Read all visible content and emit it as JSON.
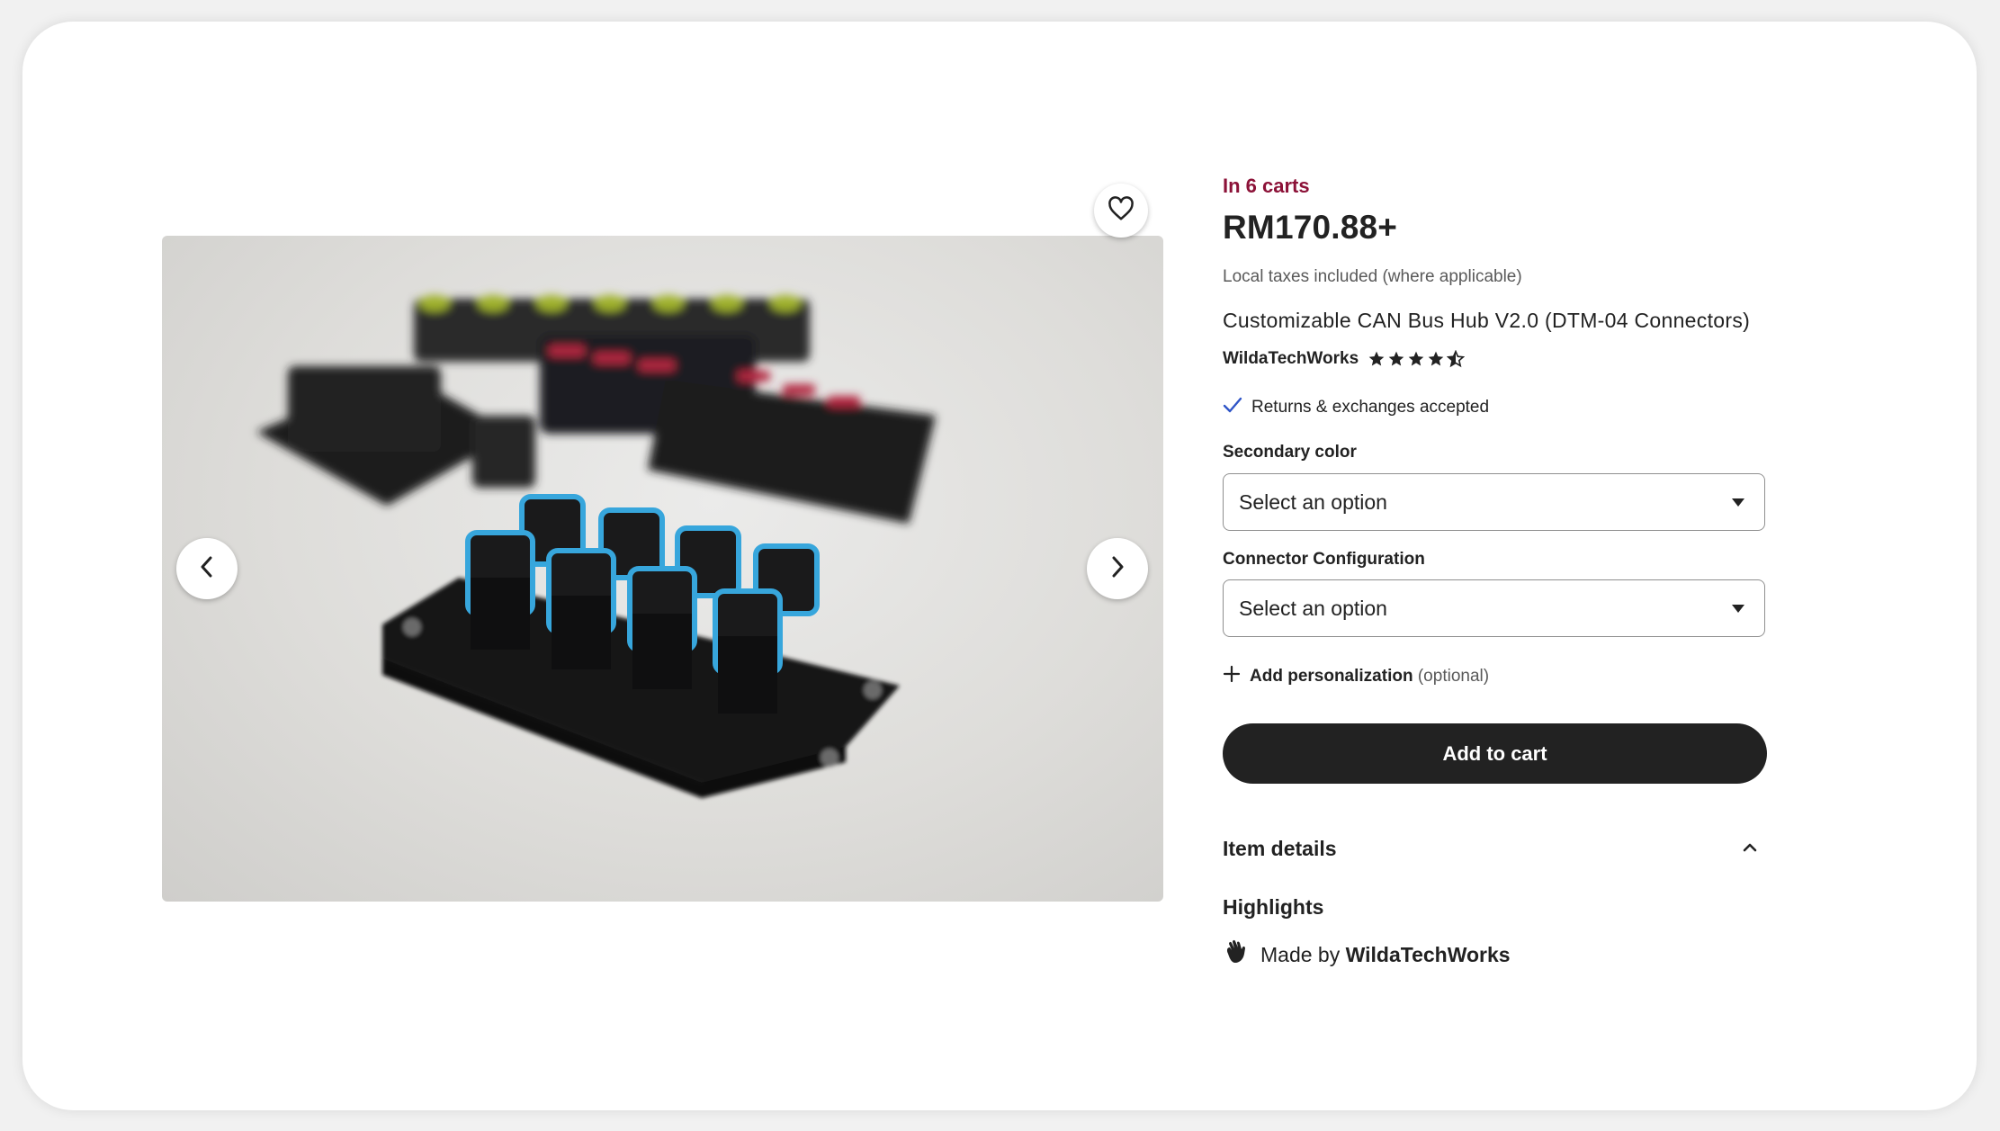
{
  "listing": {
    "in_carts": "In 6 carts",
    "price": "RM170.88+",
    "taxes_note": "Local taxes included (where applicable)",
    "title": "Customizable CAN Bus Hub V2.0 (DTM-04 Connectors)",
    "shop_name": "WildaTechWorks",
    "rating": 4.5,
    "returns": "Returns & exchanges accepted"
  },
  "options": [
    {
      "label": "Secondary color",
      "selected": "Select an option"
    },
    {
      "label": "Connector Configuration",
      "selected": "Select an option"
    }
  ],
  "personalization": {
    "label": "Add personalization",
    "optional": "(optional)"
  },
  "actions": {
    "add_to_cart": "Add to cart"
  },
  "details": {
    "title": "Item details",
    "highlights_title": "Highlights",
    "made_by_prefix": "Made by",
    "made_by_shop": "WildaTechWorks"
  },
  "icons": {
    "favorite": "heart-icon",
    "prev": "chevron-left-icon",
    "next": "chevron-right-icon",
    "check": "check-icon",
    "plus": "plus-icon",
    "collapse": "chevron-up-icon",
    "made": "hand-icon"
  },
  "colors": {
    "carts_accent": "#8c1238",
    "button": "#222222",
    "check": "#2f55c7"
  }
}
